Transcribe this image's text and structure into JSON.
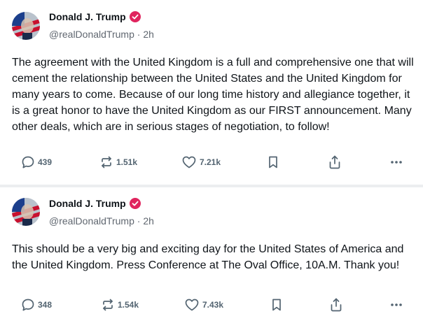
{
  "posts": [
    {
      "author": {
        "name": "Donald J. Trump",
        "handle": "@realDonaldTrump",
        "time": "2h"
      },
      "text": "The agreement with the United Kingdom is a full and comprehensive one that will cement the relationship between the United States and the United Kingdom for many years to come. Because of our long time history and allegiance together, it is a great honor to have the United Kingdom as our FIRST announcement. Many other deals, which are in serious stages of negotiation, to follow!",
      "stats": {
        "replies": "439",
        "reposts": "1.51k",
        "likes": "7.21k"
      }
    },
    {
      "author": {
        "name": "Donald J. Trump",
        "handle": "@realDonaldTrump",
        "time": "2h"
      },
      "text": "This should be a very big and exciting day for the United States of America and the United Kingdom. Press Conference at The Oval Office, 10A.M. Thank you!",
      "stats": {
        "replies": "348",
        "reposts": "1.54k",
        "likes": "7.43k"
      }
    }
  ],
  "separator": "·",
  "icons": [
    "reply-icon",
    "repost-icon",
    "like-icon",
    "bookmark-icon",
    "share-icon",
    "more-icon",
    "verified-badge-icon"
  ],
  "colors": {
    "verified": "#e0245e",
    "icon": "#536471",
    "text": "#0f1419",
    "muted": "#606770",
    "divider": "#eceef0"
  }
}
